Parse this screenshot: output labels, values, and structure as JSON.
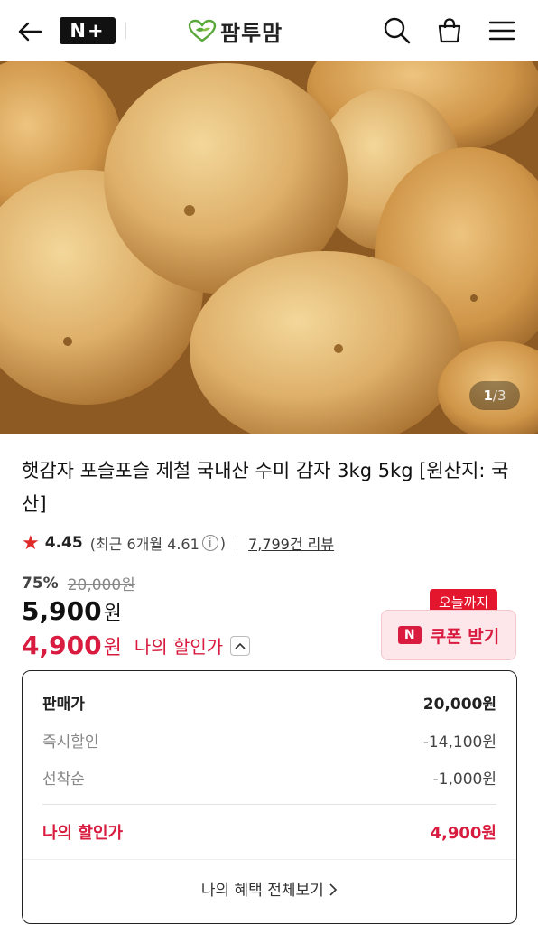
{
  "header": {
    "brand_badge": "N+",
    "logo_text": "팜투맘",
    "icons": [
      "back-arrow-icon",
      "search-icon",
      "cart-icon",
      "menu-icon"
    ]
  },
  "gallery": {
    "current": "1",
    "separator": "/",
    "total": "3"
  },
  "product": {
    "title": "햇감자 포슬포슬 제철 국내산 수미 감자 3kg 5kg [원산지: 국산]",
    "rating": "4.45",
    "rating_recent": "(최근 6개월 4.61",
    "rating_recent_close": ")",
    "review_count": "7,799건 리뷰",
    "discount_pct": "75%",
    "original_price": "20,000원",
    "sale_price": "5,900",
    "sale_price_unit": "원",
    "my_price": "4,900",
    "my_price_unit": "원",
    "my_price_label": "나의 할인가"
  },
  "coupon": {
    "tag": "오늘까지",
    "badge": "N",
    "button_label": "쿠폰 받기"
  },
  "breakdown": {
    "rows": [
      {
        "label": "판매가",
        "value": "20,000원"
      },
      {
        "label": "즉시할인",
        "value": "-14,100원"
      },
      {
        "label": "선착순",
        "value": "-1,000원"
      }
    ],
    "total_label": "나의 할인가",
    "total_value": "4,900원",
    "more_label": "나의 혜택 전체보기"
  },
  "colors": {
    "accent": "#d81b3f",
    "tag_red": "#e4162d",
    "coupon_bg": "#fde7ea"
  }
}
